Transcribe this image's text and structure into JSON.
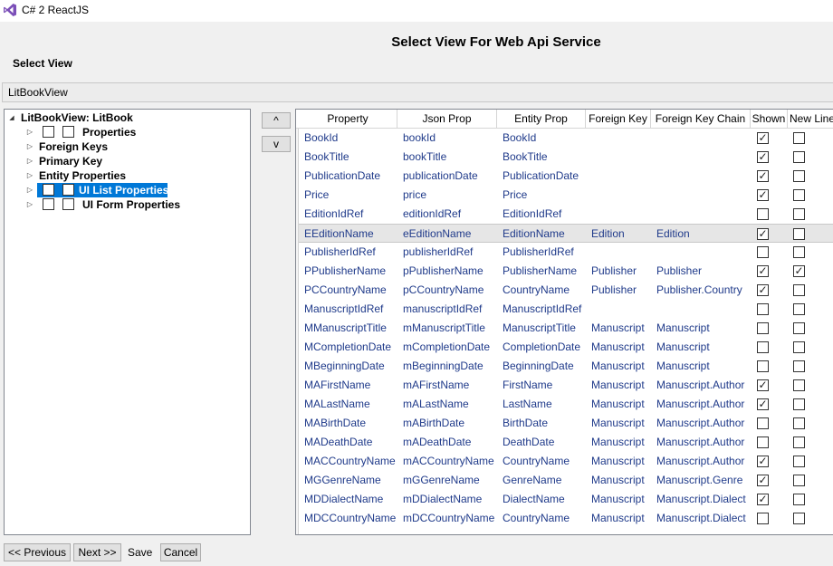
{
  "window": {
    "title": "C# 2 ReactJS"
  },
  "page": {
    "title": "Select View For Web Api Service",
    "select_view_label": "Select View"
  },
  "view_selector": {
    "value": "LitBookView"
  },
  "tree": {
    "root": "LitBookView: LitBook",
    "nodes": [
      {
        "label": "Properties"
      },
      {
        "label": "Foreign Keys"
      },
      {
        "label": "Primary Key"
      },
      {
        "label": "Entity Properties"
      },
      {
        "label": "UI List Properties"
      },
      {
        "label": "UI Form Properties"
      }
    ]
  },
  "move_buttons": {
    "up": "^",
    "down": "v"
  },
  "grid": {
    "columns": [
      "Property",
      "Json Prop",
      "Entity Prop",
      "Foreign Key",
      "Foreign Key Chain",
      "Shown",
      "New Line"
    ],
    "rows": [
      {
        "property": "BookId",
        "json": "bookId",
        "entity": "BookId",
        "fk": "",
        "fkchain": "",
        "shown": true,
        "newline": false
      },
      {
        "property": "BookTitle",
        "json": "bookTitle",
        "entity": "BookTitle",
        "fk": "",
        "fkchain": "",
        "shown": true,
        "newline": false
      },
      {
        "property": "PublicationDate",
        "json": "publicationDate",
        "entity": "PublicationDate",
        "fk": "",
        "fkchain": "",
        "shown": true,
        "newline": false
      },
      {
        "property": "Price",
        "json": "price",
        "entity": "Price",
        "fk": "",
        "fkchain": "",
        "shown": true,
        "newline": false
      },
      {
        "property": "EditionIdRef",
        "json": "editionIdRef",
        "entity": "EditionIdRef",
        "fk": "",
        "fkchain": "",
        "shown": false,
        "newline": false
      },
      {
        "property": "EEditionName",
        "json": "eEditionName",
        "entity": "EditionName",
        "fk": "Edition",
        "fkchain": "Edition",
        "shown": true,
        "newline": false
      },
      {
        "property": "PublisherIdRef",
        "json": "publisherIdRef",
        "entity": "PublisherIdRef",
        "fk": "",
        "fkchain": "",
        "shown": false,
        "newline": false
      },
      {
        "property": "PPublisherName",
        "json": "pPublisherName",
        "entity": "PublisherName",
        "fk": "Publisher",
        "fkchain": "Publisher",
        "shown": true,
        "newline": true
      },
      {
        "property": "PCCountryName",
        "json": "pCCountryName",
        "entity": "CountryName",
        "fk": "Publisher",
        "fkchain": "Publisher.Country",
        "shown": true,
        "newline": false
      },
      {
        "property": "ManuscriptIdRef",
        "json": "manuscriptIdRef",
        "entity": "ManuscriptIdRef",
        "fk": "",
        "fkchain": "",
        "shown": false,
        "newline": false
      },
      {
        "property": "MManuscriptTitle",
        "json": "mManuscriptTitle",
        "entity": "ManuscriptTitle",
        "fk": "Manuscript",
        "fkchain": "Manuscript",
        "shown": false,
        "newline": false
      },
      {
        "property": "MCompletionDate",
        "json": "mCompletionDate",
        "entity": "CompletionDate",
        "fk": "Manuscript",
        "fkchain": "Manuscript",
        "shown": false,
        "newline": false
      },
      {
        "property": "MBeginningDate",
        "json": "mBeginningDate",
        "entity": "BeginningDate",
        "fk": "Manuscript",
        "fkchain": "Manuscript",
        "shown": false,
        "newline": false
      },
      {
        "property": "MAFirstName",
        "json": "mAFirstName",
        "entity": "FirstName",
        "fk": "Manuscript",
        "fkchain": "Manuscript.Author",
        "shown": true,
        "newline": false
      },
      {
        "property": "MALastName",
        "json": "mALastName",
        "entity": "LastName",
        "fk": "Manuscript",
        "fkchain": "Manuscript.Author",
        "shown": true,
        "newline": false
      },
      {
        "property": "MABirthDate",
        "json": "mABirthDate",
        "entity": "BirthDate",
        "fk": "Manuscript",
        "fkchain": "Manuscript.Author",
        "shown": false,
        "newline": false
      },
      {
        "property": "MADeathDate",
        "json": "mADeathDate",
        "entity": "DeathDate",
        "fk": "Manuscript",
        "fkchain": "Manuscript.Author",
        "shown": false,
        "newline": false
      },
      {
        "property": "MACCountryName",
        "json": "mACCountryName",
        "entity": "CountryName",
        "fk": "Manuscript",
        "fkchain": "Manuscript.Author",
        "shown": true,
        "newline": false
      },
      {
        "property": "MGGenreName",
        "json": "mGGenreName",
        "entity": "GenreName",
        "fk": "Manuscript",
        "fkchain": "Manuscript.Genre",
        "shown": true,
        "newline": false
      },
      {
        "property": "MDDialectName",
        "json": "mDDialectName",
        "entity": "DialectName",
        "fk": "Manuscript",
        "fkchain": "Manuscript.Dialect",
        "shown": true,
        "newline": false
      },
      {
        "property": "MDCCountryName",
        "json": "mDCCountryName",
        "entity": "CountryName",
        "fk": "Manuscript",
        "fkchain": "Manuscript.Dialect",
        "shown": false,
        "newline": false
      }
    ]
  },
  "footer": {
    "previous": "<< Previous",
    "next": "Next >>",
    "save": "Save",
    "cancel": "Cancel"
  },
  "colors": {
    "accent": "#0078d7",
    "cell_text": "#1f3a8a",
    "logo": "#7b4fb8"
  }
}
